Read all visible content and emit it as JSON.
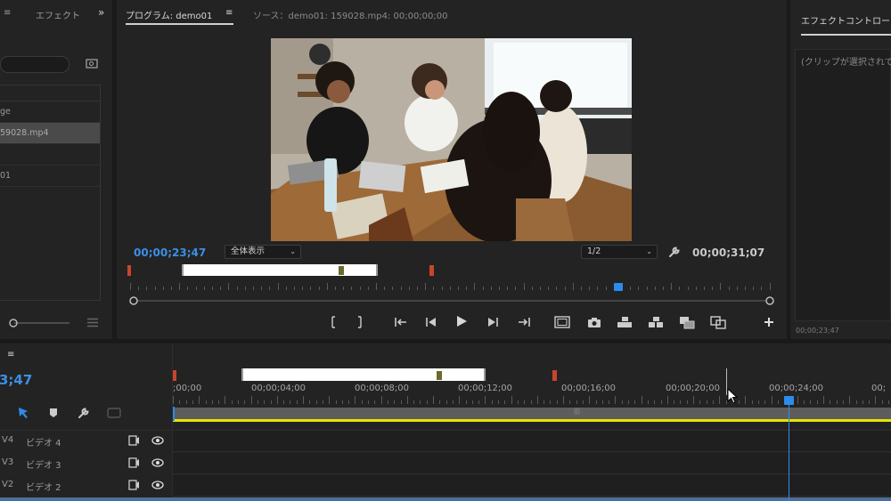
{
  "project_panel": {
    "tabs": [
      "≡",
      "エフェクト",
      "»"
    ],
    "list": [
      {
        "label": "ge"
      },
      {
        "label": "59028.mp4",
        "selected": true
      },
      {
        "label": ""
      },
      {
        "label": "01"
      }
    ]
  },
  "program_monitor": {
    "tab_label": "プログラム: demo01",
    "menu_icon": "≡",
    "source_tab": "ソース：demo01: 159028.mp4: 00;00;00;00",
    "current_timecode": "00;00;23;47",
    "zoom_select": "全体表示",
    "resolution_select": "1/2",
    "duration_timecode": "00;00;31;07",
    "playhead_fraction": 0.76,
    "in_point_fraction": 0.085,
    "out_point_fraction": 0.38,
    "marker_fraction": 0.33,
    "icons": [
      "mark-in-icon",
      "mark-out-icon",
      "go-to-in-icon",
      "step-back-icon",
      "play-icon",
      "step-forward-icon",
      "go-to-out-icon",
      "safe-margins-icon",
      "export-frame-icon",
      "lift-icon",
      "extract-icon",
      "compare-icon",
      "comparison-view-icon",
      "add-button-icon"
    ]
  },
  "effect_controls": {
    "tab_label": "エフェクトコントロー",
    "placeholder": "(クリップが選択されて",
    "footer_timecode": "00;00;23;47"
  },
  "timeline": {
    "menu_icon": "≡",
    "current_timecode": "3;47",
    "ruler_labels": [
      ";00;00",
      "00;00;04;00",
      "00;00;08;00",
      "00;00;12;00",
      "00;00;16;00",
      "00;00;20;00",
      "00;00;24;00",
      "00;"
    ],
    "tracks": [
      {
        "id": "V4",
        "name": "ビデオ 4"
      },
      {
        "id": "V3",
        "name": "ビデオ 3"
      },
      {
        "id": "V2",
        "name": "ビデオ 2"
      }
    ],
    "work_area_grip": "|||",
    "colors": {
      "accent": "#2d8ceb",
      "work_area": "#e6e600",
      "marker": "#c8462c",
      "marker_olive": "#6b6a2c"
    }
  }
}
